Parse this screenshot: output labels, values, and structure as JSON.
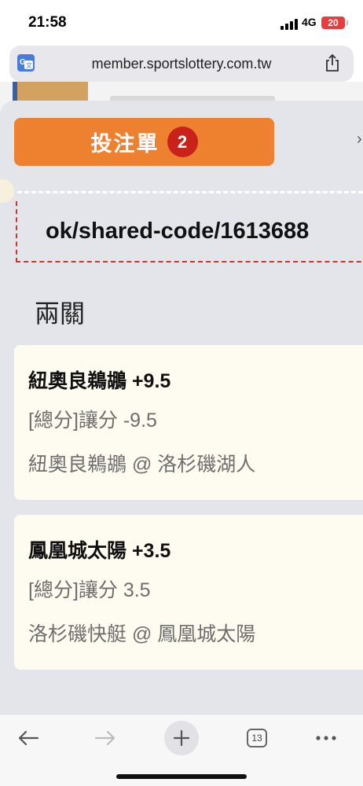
{
  "status": {
    "time": "21:58",
    "network": "4G",
    "battery": "20"
  },
  "browser": {
    "url": "member.sportslottery.com.tw",
    "tab_count": "13"
  },
  "bet_slip": {
    "button_label": "投注單",
    "count": "2",
    "share_code": "ok/shared-code/1613688",
    "parlay_type": "兩關",
    "selections": [
      {
        "title": "紐奧良鵜鶘 +9.5",
        "market": "[總分]讓分 -9.5",
        "matchup": "紐奧良鵜鶘 @ 洛杉磯湖人"
      },
      {
        "title": "鳳凰城太陽 +3.5",
        "market": "[總分]讓分 3.5",
        "matchup": "洛杉磯快艇 @ 鳳凰城太陽"
      }
    ]
  },
  "colors": {
    "accent": "#ee8130",
    "badge": "#c9221a",
    "card": "#fefbf1",
    "sheet": "#e4e5ea"
  },
  "icons": [
    "translate-icon",
    "share-icon",
    "back-arrow-icon",
    "forward-arrow-icon",
    "plus-icon",
    "tabs-icon",
    "more-icon"
  ]
}
